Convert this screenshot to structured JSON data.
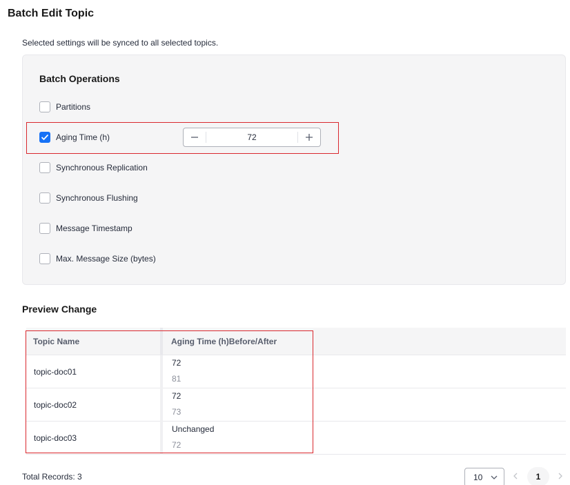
{
  "page": {
    "title": "Batch Edit Topic",
    "description": "Selected settings will be synced to all selected topics."
  },
  "batch_operations": {
    "title": "Batch Operations",
    "options": [
      {
        "label": "Partitions",
        "checked": false
      },
      {
        "label": "Aging Time (h)",
        "checked": true
      },
      {
        "label": "Synchronous Replication",
        "checked": false
      },
      {
        "label": "Synchronous Flushing",
        "checked": false
      },
      {
        "label": "Message Timestamp",
        "checked": false
      },
      {
        "label": "Max. Message Size (bytes)",
        "checked": false
      }
    ],
    "aging_time_value": "72"
  },
  "preview": {
    "title": "Preview Change",
    "columns": [
      "Topic Name",
      "Aging Time (h)Before/After"
    ],
    "rows": [
      {
        "name": "topic-doc01",
        "after": "72",
        "before": "81"
      },
      {
        "name": "topic-doc02",
        "after": "72",
        "before": "73"
      },
      {
        "name": "topic-doc03",
        "after": "Unchanged",
        "before": "72"
      }
    ]
  },
  "pagination": {
    "total": "Total Records: 3",
    "page_size": "10",
    "current_page": "1"
  },
  "colors": {
    "accent": "#1772f6",
    "highlight": "#d9262c"
  }
}
